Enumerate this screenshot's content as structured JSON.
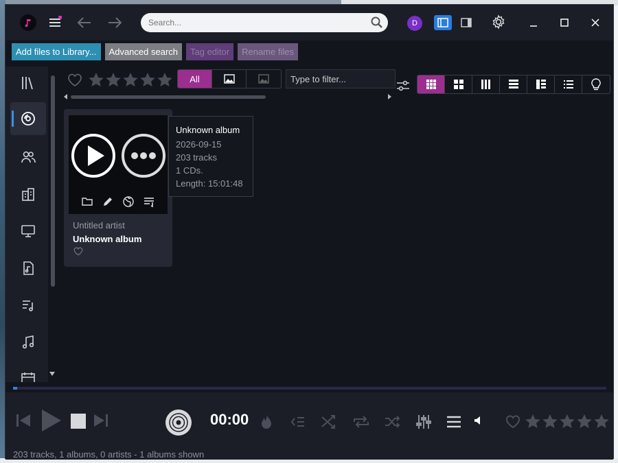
{
  "search": {
    "placeholder": "Search..."
  },
  "user": {
    "initial": "D"
  },
  "actions": {
    "add_files": "Add files to Library...",
    "advanced_search": "Advanced search",
    "tag_editor": "Tag editor",
    "rename_files": "Rename files"
  },
  "filter": {
    "segments": [
      "All"
    ],
    "placeholder": "Type to filter..."
  },
  "album_card": {
    "artist": "Untitled artist",
    "album": "Unknown album"
  },
  "tooltip": {
    "title": "Unknown album",
    "date": "2026-09-15",
    "tracks": "203 tracks",
    "cds": "1 CDs.",
    "length": "Length: 15:01:48"
  },
  "player": {
    "time": "00:00",
    "progress": 0.007
  },
  "status_text": "203 tracks, 1 albums, 0 artists - 1 albums shown",
  "colors": {
    "accent": "#9b2f8f",
    "brand_blue": "#2b7de0",
    "add_button": "#2d8fb2",
    "avatar": "#7b2fc7"
  }
}
